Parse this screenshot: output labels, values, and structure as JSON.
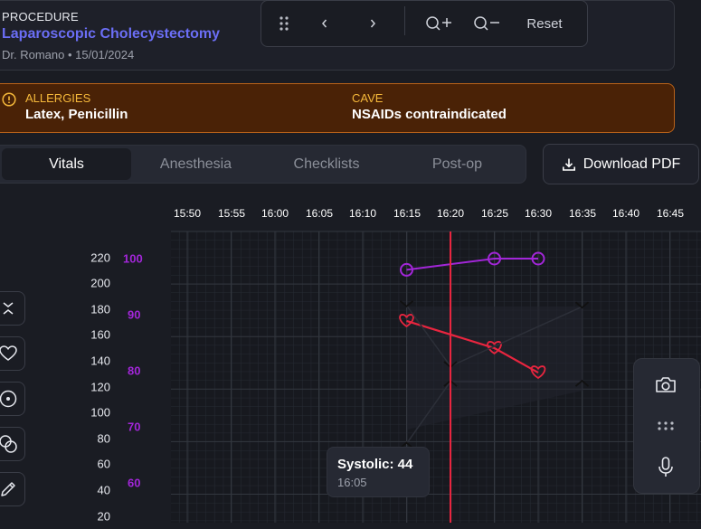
{
  "procedure": {
    "label": "PROCEDURE",
    "name": "Laparoscopic Cholecystectomy",
    "meta": "Dr. Romano • 15/01/2024"
  },
  "toolbar": {
    "reset_label": "Reset",
    "icons": [
      "drag-handle-icon",
      "chevron-left-icon",
      "chevron-right-icon",
      "zoom-in-icon",
      "zoom-out-icon"
    ]
  },
  "alerts": {
    "allergies_label": "ALLERGIES",
    "allergies_value": "Latex, Penicillin",
    "caution_label": "CAVE",
    "caution_value": "NSAIDs contraindicated"
  },
  "tabs": [
    {
      "label": "Vitals",
      "active": true
    },
    {
      "label": "Anesthesia",
      "active": false
    },
    {
      "label": "Checklists",
      "active": false
    },
    {
      "label": "Post-op",
      "active": false
    }
  ],
  "download_label": "Download PDF",
  "time_labels": [
    "15:50",
    "15:55",
    "16:00",
    "16:05",
    "16:10",
    "16:15",
    "16:20",
    "16:25",
    "16:30",
    "16:35",
    "16:40",
    "16:45"
  ],
  "bp_axis_labels": [
    "220",
    "200",
    "180",
    "160",
    "140",
    "120",
    "100",
    "80",
    "60",
    "40",
    "20"
  ],
  "spo2_axis_labels": [
    "100",
    "90",
    "80",
    "70",
    "60"
  ],
  "tooltip": {
    "title": "Systolic: 44",
    "time": "16:05"
  },
  "colors": {
    "accent": "#6b6ef5",
    "spo2": "#a226d8",
    "heart_rate": "#e8253f",
    "now_line": "#e8253f",
    "warning": "#f5b83a",
    "blood_pressure_marker": "#111111"
  },
  "chart_data": {
    "type": "line",
    "x": [
      "16:15",
      "16:20",
      "16:25",
      "16:30",
      "16:35"
    ],
    "series": [
      {
        "values": [
          98,
          null,
          100,
          100,
          null
        ]
      },
      {
        "values": [
          171,
          null,
          150,
          131,
          null
        ]
      },
      {
        "values": [
          183,
          136,
          null,
          null,
          182
        ]
      },
      {
        "values": [
          76,
          124,
          null,
          null,
          124
        ]
      }
    ],
    "current_time": "16:20"
  }
}
